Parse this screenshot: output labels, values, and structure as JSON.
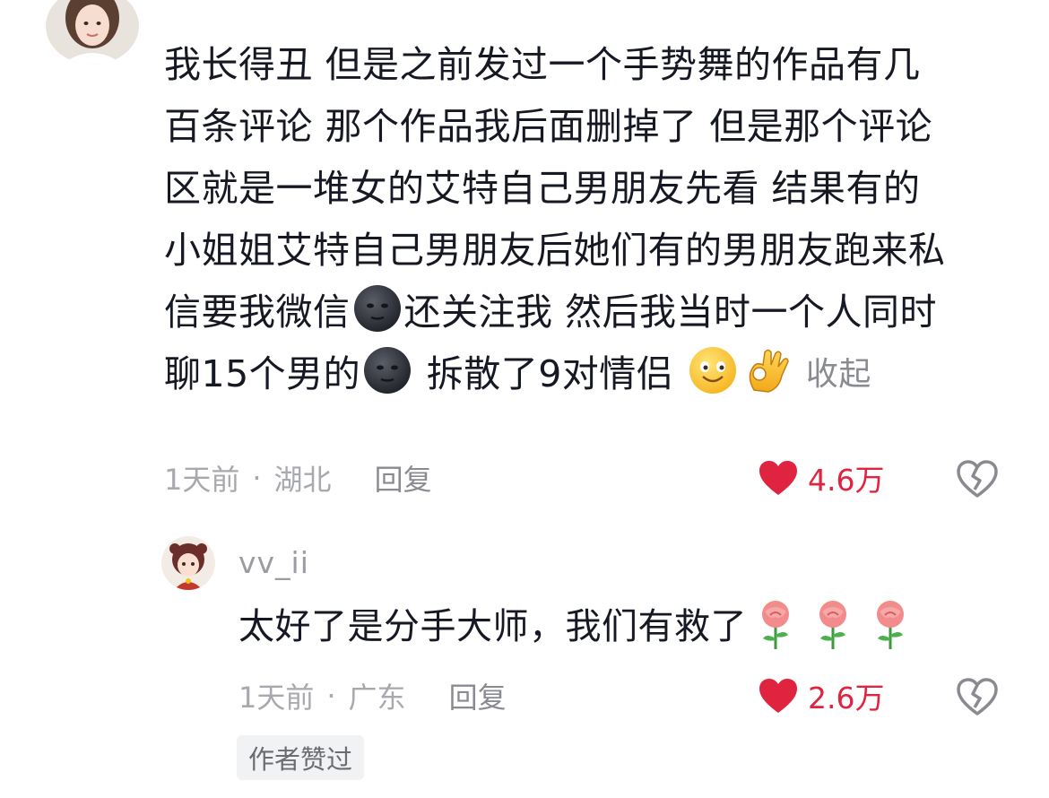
{
  "comment": {
    "lines": [
      "我长得丑 但是之前发过一个手势舞的作品有几",
      "百条评论 那个作品我后面删掉了 但是那个评论",
      "区就是一堆女的艾特自己男朋友先看 结果有的",
      "小姐姐艾特自己男朋友后她们有的男朋友跑来私"
    ],
    "line5_a": "信要我微信",
    "line5_b": "还关注我 然后我当时一个人同时",
    "line6_a": "聊15个男的",
    "line6_b": " 拆散了9对情侣 ",
    "collapse_label": "收起",
    "time": "1天前",
    "location": "湖北",
    "reply_label": "回复",
    "likes": "4.6万",
    "separator": "·"
  },
  "reply": {
    "username": "vv_ii",
    "text": "太好了是分手大师，我们有救了",
    "time": "1天前",
    "location": "广东",
    "reply_label": "回复",
    "likes": "2.6万",
    "separator": "·",
    "author_badge": "作者赞过"
  },
  "icons": {
    "emoji_dark_moon": "new-moon-face-icon",
    "emoji_smile": "smiling-face-icon",
    "emoji_ok": "ok-hand-icon",
    "emoji_rose": "rose-icon",
    "like": "heart-icon",
    "dislike": "broken-heart-icon"
  },
  "colors": {
    "like_red": "#e0243f",
    "meta_gray": "#a8a9ae",
    "text": "#161823"
  }
}
